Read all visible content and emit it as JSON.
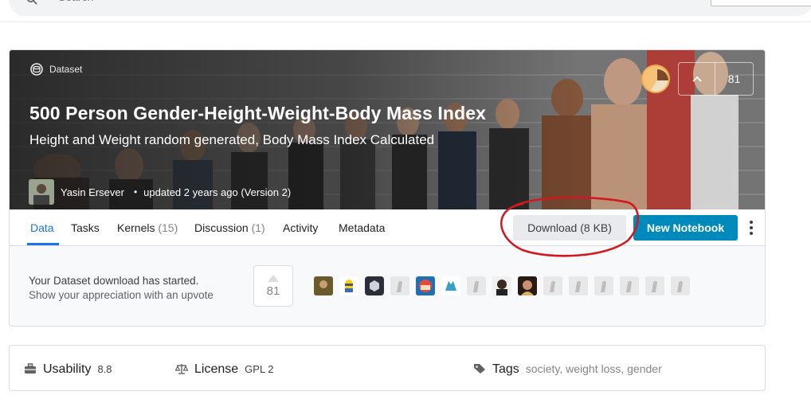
{
  "search": {
    "placeholder": "Search"
  },
  "dataset": {
    "type_label": "Dataset",
    "title": "500 Person Gender-Height-Weight-Body Mass Index",
    "subtitle": "Height and Weight random generated, Body Mass Index Calculated",
    "author": "Yasin Ersever",
    "updated": "updated 2 years ago (Version 2)",
    "upvotes": "81"
  },
  "tabs": [
    {
      "label": "Data",
      "count": ""
    },
    {
      "label": "Tasks",
      "count": ""
    },
    {
      "label": "Kernels",
      "count": "(15)"
    },
    {
      "label": "Discussion",
      "count": "(1)"
    },
    {
      "label": "Activity",
      "count": ""
    },
    {
      "label": "Metadata",
      "count": ""
    }
  ],
  "actions": {
    "download_label": "Download (8 KB)",
    "new_notebook_label": "New Notebook"
  },
  "notice": {
    "line1": "Your Dataset download has started.",
    "line2": "Show your appreciation with an upvote",
    "upvote_count": "81"
  },
  "info": {
    "usability_label": "Usability",
    "usability_value": "8.8",
    "license_label": "License",
    "license_value": "GPL 2",
    "tags_label": "Tags",
    "tags_value": "society, weight loss, gender"
  },
  "colors": {
    "accent": "#1a73e8",
    "primary_button": "#008abc",
    "annotation": "#d0191f"
  }
}
